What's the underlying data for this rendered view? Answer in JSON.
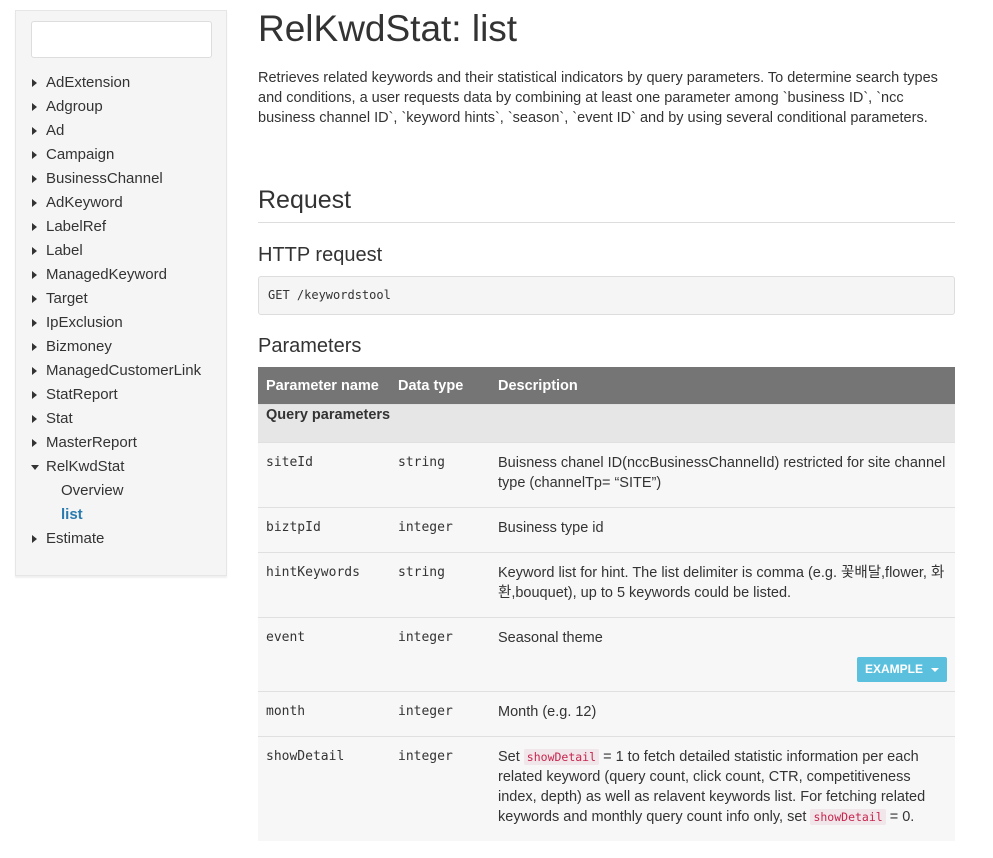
{
  "sidebar": {
    "search_value": "",
    "items": [
      {
        "label": "AdExtension"
      },
      {
        "label": "Adgroup"
      },
      {
        "label": "Ad"
      },
      {
        "label": "Campaign"
      },
      {
        "label": "BusinessChannel"
      },
      {
        "label": "AdKeyword"
      },
      {
        "label": "LabelRef"
      },
      {
        "label": "Label"
      },
      {
        "label": "ManagedKeyword"
      },
      {
        "label": "Target"
      },
      {
        "label": "IpExclusion"
      },
      {
        "label": "Bizmoney"
      },
      {
        "label": "ManagedCustomerLink"
      },
      {
        "label": "StatReport"
      },
      {
        "label": "Stat"
      },
      {
        "label": "MasterReport"
      },
      {
        "label": "RelKwdStat",
        "expanded": true,
        "children": [
          {
            "label": "Overview"
          },
          {
            "label": "list",
            "active": true
          }
        ]
      },
      {
        "label": "Estimate"
      }
    ]
  },
  "main": {
    "title": "RelKwdStat: list",
    "intro": "Retrieves related keywords and their statistical indicators by query parameters. To determine search types and conditions, a user requests data by combining at least one parameter among `business ID`, `ncc business channel ID`, `keyword hints`, `season`, `event ID` and by using several conditional parameters.",
    "request_heading": "Request",
    "http_heading": "HTTP request",
    "http_request": "GET /keywordstool",
    "params_heading": "Parameters",
    "table": {
      "headers": [
        "Parameter name",
        "Data type",
        "Description"
      ],
      "group_label": "Query parameters",
      "rows": [
        {
          "name": "siteId",
          "type": "string",
          "desc": "Buisness chanel ID(nccBusinessChannelId) restricted for site channel type (channelTp= “SITE”)"
        },
        {
          "name": "biztpId",
          "type": "integer",
          "desc": "Business type id"
        },
        {
          "name": "hintKeywords",
          "type": "string",
          "desc": "Keyword list for hint. The list delimiter is comma (e.g. 꽃배달,flower, 화환,bouquet), up to 5 keywords could be listed."
        },
        {
          "name": "event",
          "type": "integer",
          "desc": "Seasonal theme",
          "button": "EXAMPLE"
        },
        {
          "name": "month",
          "type": "integer",
          "desc": "Month (e.g. 12)"
        },
        {
          "name": "showDetail",
          "type": "integer",
          "desc_parts": [
            "Set ",
            "showDetail",
            " = 1 to fetch detailed statistic information per each related keyword (query count, click count, CTR, competitiveness index, depth) as well as relavent keywords list. For fetching related keywords and monthly query count info only, set ",
            "showDetail",
            " = 0."
          ]
        }
      ]
    }
  },
  "colors": {
    "header_bg": "#757575",
    "group_bg": "#e6e6e6",
    "active_link": "#2a7ab0",
    "button_bg": "#5bc0de",
    "inline_code": "#c7254e"
  }
}
